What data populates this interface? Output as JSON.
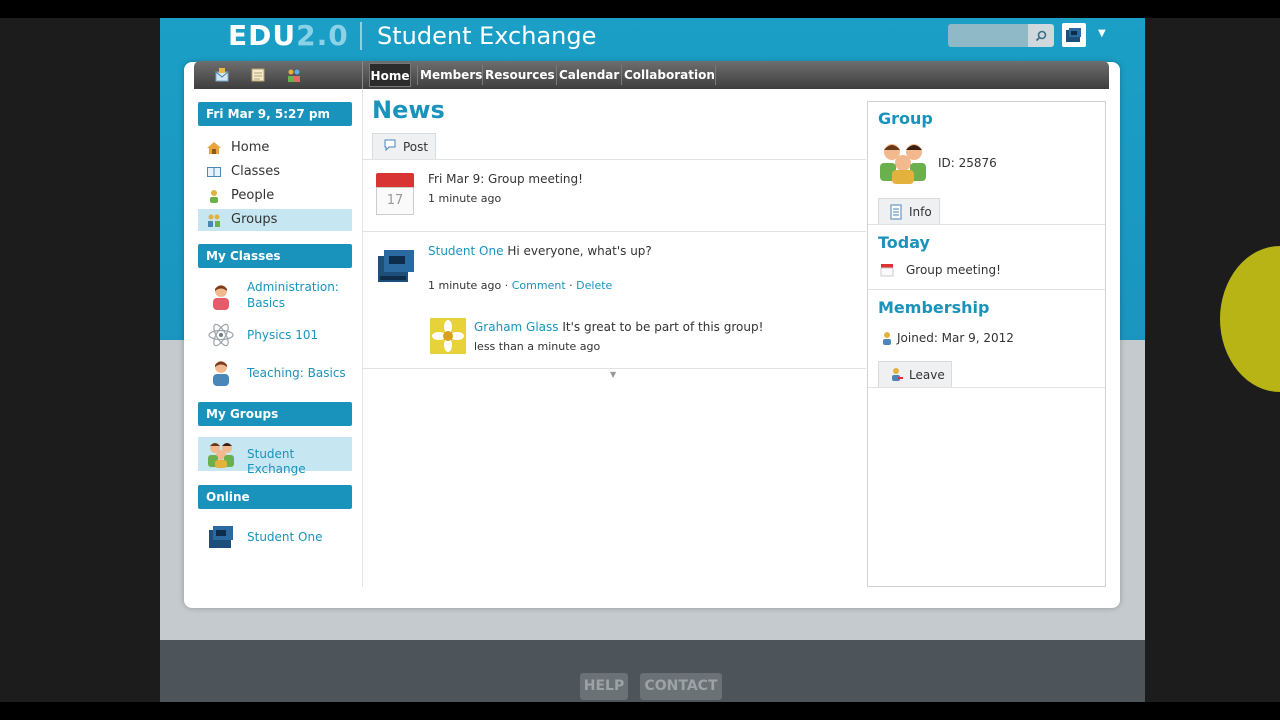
{
  "app": {
    "logo_main": "EDU",
    "logo_version": "2.0",
    "title": "Student Exchange"
  },
  "header": {
    "search_placeholder": ""
  },
  "nav": {
    "icons": [
      "mail-icon",
      "notes-icon",
      "people-icon"
    ],
    "tabs": [
      {
        "label": "Home",
        "active": true
      },
      {
        "label": "Members",
        "active": false
      },
      {
        "label": "Resources",
        "active": false
      },
      {
        "label": "Calendar",
        "active": false
      },
      {
        "label": "Collaboration",
        "active": false
      }
    ]
  },
  "sidebar": {
    "date": "Fri Mar 9, 5:27 pm",
    "items": [
      {
        "label": "Home",
        "icon": "house-icon"
      },
      {
        "label": "Classes",
        "icon": "book-icon"
      },
      {
        "label": "People",
        "icon": "person-icon"
      },
      {
        "label": "Groups",
        "icon": "group-icon",
        "selected": true
      }
    ],
    "my_classes_header": "My Classes",
    "classes": [
      {
        "label_line1": "Administration:",
        "label_line2": "Basics",
        "icon": "teacher-icon"
      },
      {
        "label_line1": "Physics 101",
        "label_line2": "",
        "icon": "atom-icon"
      },
      {
        "label_line1": "Teaching: Basics",
        "label_line2": "",
        "icon": "teacher-icon"
      }
    ],
    "my_groups_header": "My Groups",
    "groups": [
      {
        "label": "Student Exchange",
        "icon": "group-icon"
      }
    ],
    "online_header": "Online",
    "online": [
      {
        "label": "Student One",
        "icon": "avatar-icon"
      }
    ]
  },
  "news": {
    "title": "News",
    "post_tab": "Post",
    "calendar_day": "17",
    "items": [
      {
        "link": "Fri Mar 9: Group meeting!",
        "time": "1 minute ago"
      },
      {
        "author": "Student One",
        "text": "Hi everyone, what's up?",
        "time": "1 minute ago",
        "sep": "·",
        "comment_label": "Comment",
        "delete_label": "Delete",
        "reply": {
          "author": "Graham Glass",
          "text": "It's great to be part of this group!",
          "time": "less than a minute ago"
        }
      }
    ]
  },
  "right_panel": {
    "group_title": "Group",
    "group_id": "ID: 25876",
    "info_btn": "Info",
    "today_title": "Today",
    "today_event": "Group meeting!",
    "membership_title": "Membership",
    "joined": "Joined: Mar 9, 2012",
    "leave_btn": "Leave"
  },
  "footer": {
    "help": "HELP",
    "contact": "CONTACT"
  },
  "colors": {
    "accent": "#1a93bc",
    "header_blue": "#1b9fc6",
    "navbar": "#4e4e4e"
  }
}
